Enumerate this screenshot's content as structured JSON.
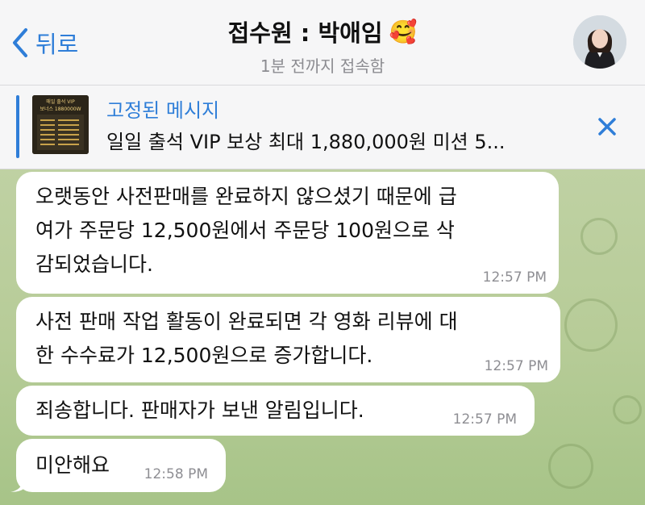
{
  "header": {
    "back_label": "뒤로",
    "title": "접수원 : 박애임",
    "title_emoji": "🥰",
    "subtitle": "1분 전까지 접속함"
  },
  "pinned": {
    "title": "고정된 메시지",
    "text": "일일 출석 VIP 보상 최대 1,880,000원 미션 5...",
    "thumb_line1": "매일 출석 VIP",
    "thumb_line2": "보너스 1880000W"
  },
  "messages": [
    {
      "lines": [
        "오랫동안 사전판매를 완료하지 않으셨기 때문에 급",
        "여가 주문당 12,500원에서 주문당 100원으로 삭",
        "감되었습니다."
      ],
      "time": "12:57 PM"
    },
    {
      "lines": [
        "사전 판매 작업 활동이 완료되면 각 영화 리뷰에 대",
        "한 수수료가 12,500원으로 증가합니다."
      ],
      "time": "12:57 PM"
    },
    {
      "lines": [
        "죄송합니다. 판매자가 보낸 알림입니다."
      ],
      "time": "12:57 PM"
    },
    {
      "lines": [
        "미안해요"
      ],
      "time": "12:58 PM"
    }
  ],
  "colors": {
    "accent": "#2f7ed8",
    "bubble": "#ffffff",
    "chat_background": "#b9cd9b"
  },
  "icons": {
    "back": "chevron-left-icon",
    "close": "close-icon"
  }
}
